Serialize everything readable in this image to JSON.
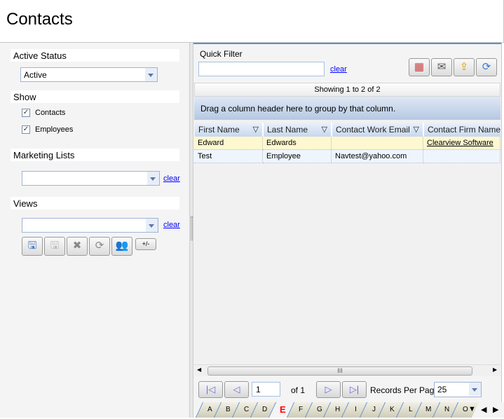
{
  "header": {
    "title": "Contacts"
  },
  "left": {
    "active_status": {
      "label": "Active Status",
      "value": "Active"
    },
    "show": {
      "label": "Show",
      "items": [
        {
          "label": "Contacts",
          "checked": true
        },
        {
          "label": "Employees",
          "checked": true
        }
      ]
    },
    "marketing_lists": {
      "label": "Marketing Lists",
      "value": "",
      "clear": "clear"
    },
    "views": {
      "label": "Views",
      "value": "",
      "clear": "clear",
      "toggle_label": "+/-"
    }
  },
  "right": {
    "quick_filter": {
      "label": "Quick Filter",
      "value": "",
      "clear": "clear"
    },
    "toolbar": [
      "columns-icon",
      "email-icon",
      "export-icon",
      "refresh-icon"
    ],
    "showing": "Showing 1 to 2 of 2",
    "group_hint": "Drag a column header here to group by that column.",
    "columns": [
      "First Name",
      "Last Name",
      "Contact Work Email",
      "Contact Firm Name"
    ],
    "rows": [
      [
        "Edward",
        "Edwards",
        "",
        "Clearview Software"
      ],
      [
        "Test",
        "Employee",
        "Navtest@yahoo.com",
        ""
      ]
    ],
    "pager": {
      "page": "1",
      "of": "of 1",
      "records_label": "Records Per Page",
      "records_value": "25"
    },
    "letters": [
      "A",
      "B",
      "C",
      "D",
      "E",
      "F",
      "G",
      "H",
      "I",
      "J",
      "K",
      "L",
      "M",
      "N",
      "O"
    ],
    "active_letter": "E",
    "colors": {
      "selected_row": "#fdf8d0",
      "alt_row": "#eef5fd",
      "accent": "#5b8fd0",
      "active_letter": "#ff0000"
    }
  }
}
